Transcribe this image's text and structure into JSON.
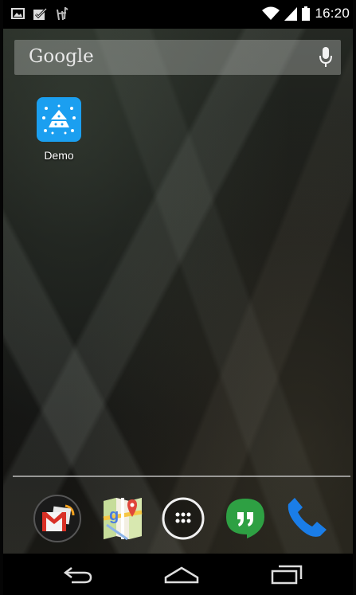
{
  "status_bar": {
    "time": "16:20",
    "icons": [
      "picture-notification-icon",
      "checkbox-notification-icon",
      "app-notification-icon",
      "wifi-icon",
      "signal-icon",
      "battery-icon"
    ]
  },
  "search_bar": {
    "label": "Google",
    "mic_icon": "mic-icon"
  },
  "apps": [
    {
      "label": "Demo",
      "icon": "demo-app-icon",
      "color": "#1b9ff0"
    }
  ],
  "dock": [
    {
      "icon": "gmail-icon"
    },
    {
      "icon": "maps-icon"
    },
    {
      "icon": "app-drawer-icon"
    },
    {
      "icon": "hangouts-icon"
    },
    {
      "icon": "phone-icon"
    }
  ],
  "nav_bar": {
    "icons": [
      "back-icon",
      "home-icon",
      "recents-icon"
    ]
  }
}
